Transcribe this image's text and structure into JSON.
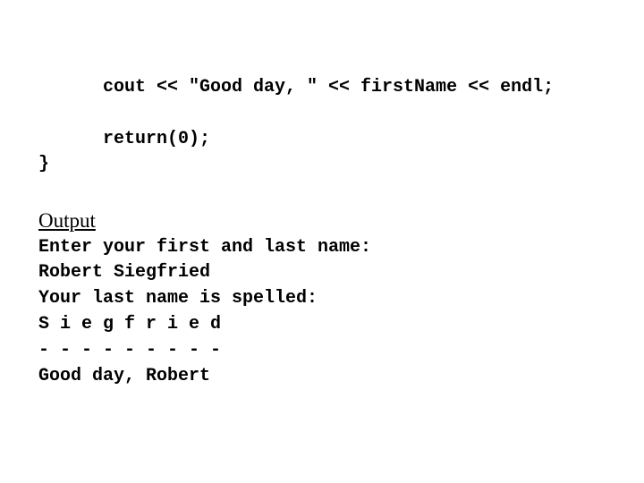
{
  "code": {
    "lines": [
      "cout << \"Good day, \" << firstName << endl;",
      "return(0);",
      "}"
    ]
  },
  "output_section": {
    "heading": "Output",
    "lines": [
      "Enter your first and last name:",
      "Robert Siegfried",
      "Your last name is spelled:",
      "S i e g f r i e d",
      "- - - - - - - - -",
      "Good day, Robert"
    ]
  }
}
